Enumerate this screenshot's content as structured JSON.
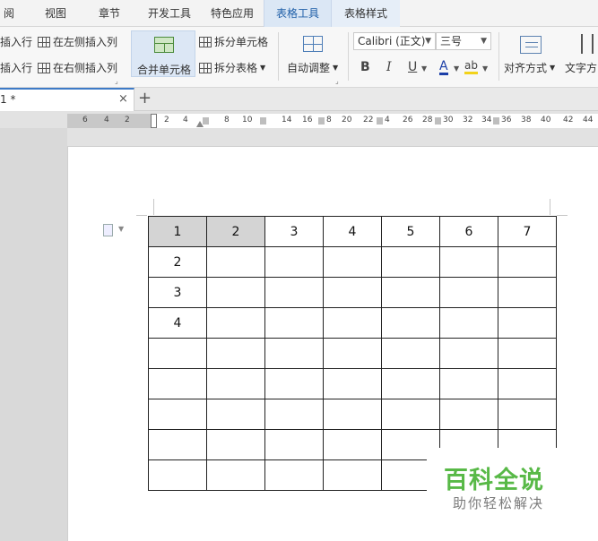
{
  "menu": {
    "tabs": [
      "阅",
      "视图",
      "章节",
      "开发工具",
      "特色应用",
      "表格工具",
      "表格样式"
    ],
    "active_tab": "表格工具"
  },
  "ribbon": {
    "insert_row_above": "插入行",
    "insert_row_below": "插入行",
    "insert_col_left": "在左侧插入列",
    "insert_col_right": "在右侧插入列",
    "merge_cells": "合并单元格",
    "split_cells": "拆分单元格",
    "split_table": "拆分表格",
    "autofit": "自动调整",
    "font_name": "Calibri (正文)",
    "font_size": "三号",
    "bold": "B",
    "italic": "I",
    "underline": "U",
    "font_color": "A",
    "highlight": "ab",
    "alignment": "对齐方式",
    "text_direction": "文字方"
  },
  "doc_tab": {
    "name": "1 *",
    "new_tab": "+"
  },
  "ruler": {
    "labels": [
      "6",
      "4",
      "2",
      "2",
      "4",
      "8",
      "10",
      "14",
      "16",
      "8",
      "20",
      "22",
      "4",
      "26",
      "28",
      "30",
      "32",
      "34",
      "36",
      "38",
      "40",
      "42",
      "44"
    ]
  },
  "table": {
    "rows": [
      [
        "1",
        "2",
        "3",
        "4",
        "5",
        "6",
        "7"
      ],
      [
        "2",
        "",
        "",
        "",
        "",
        "",
        ""
      ],
      [
        "3",
        "",
        "",
        "",
        "",
        "",
        ""
      ],
      [
        "4",
        "",
        "",
        "",
        "",
        "",
        ""
      ],
      [
        "",
        "",
        "",
        "",
        "",
        "",
        ""
      ],
      [
        "",
        "",
        "",
        "",
        "",
        "",
        ""
      ],
      [
        "",
        "",
        "",
        "",
        "",
        "",
        ""
      ],
      [
        "",
        "",
        "",
        "",
        "",
        "",
        ""
      ],
      [
        "",
        "",
        "",
        "",
        "",
        "",
        ""
      ]
    ],
    "selected_cells": [
      [
        0,
        0
      ],
      [
        0,
        1
      ]
    ]
  },
  "watermark": {
    "title": "百科全说",
    "subtitle": "助你轻松解决",
    "color": "#58b947"
  }
}
